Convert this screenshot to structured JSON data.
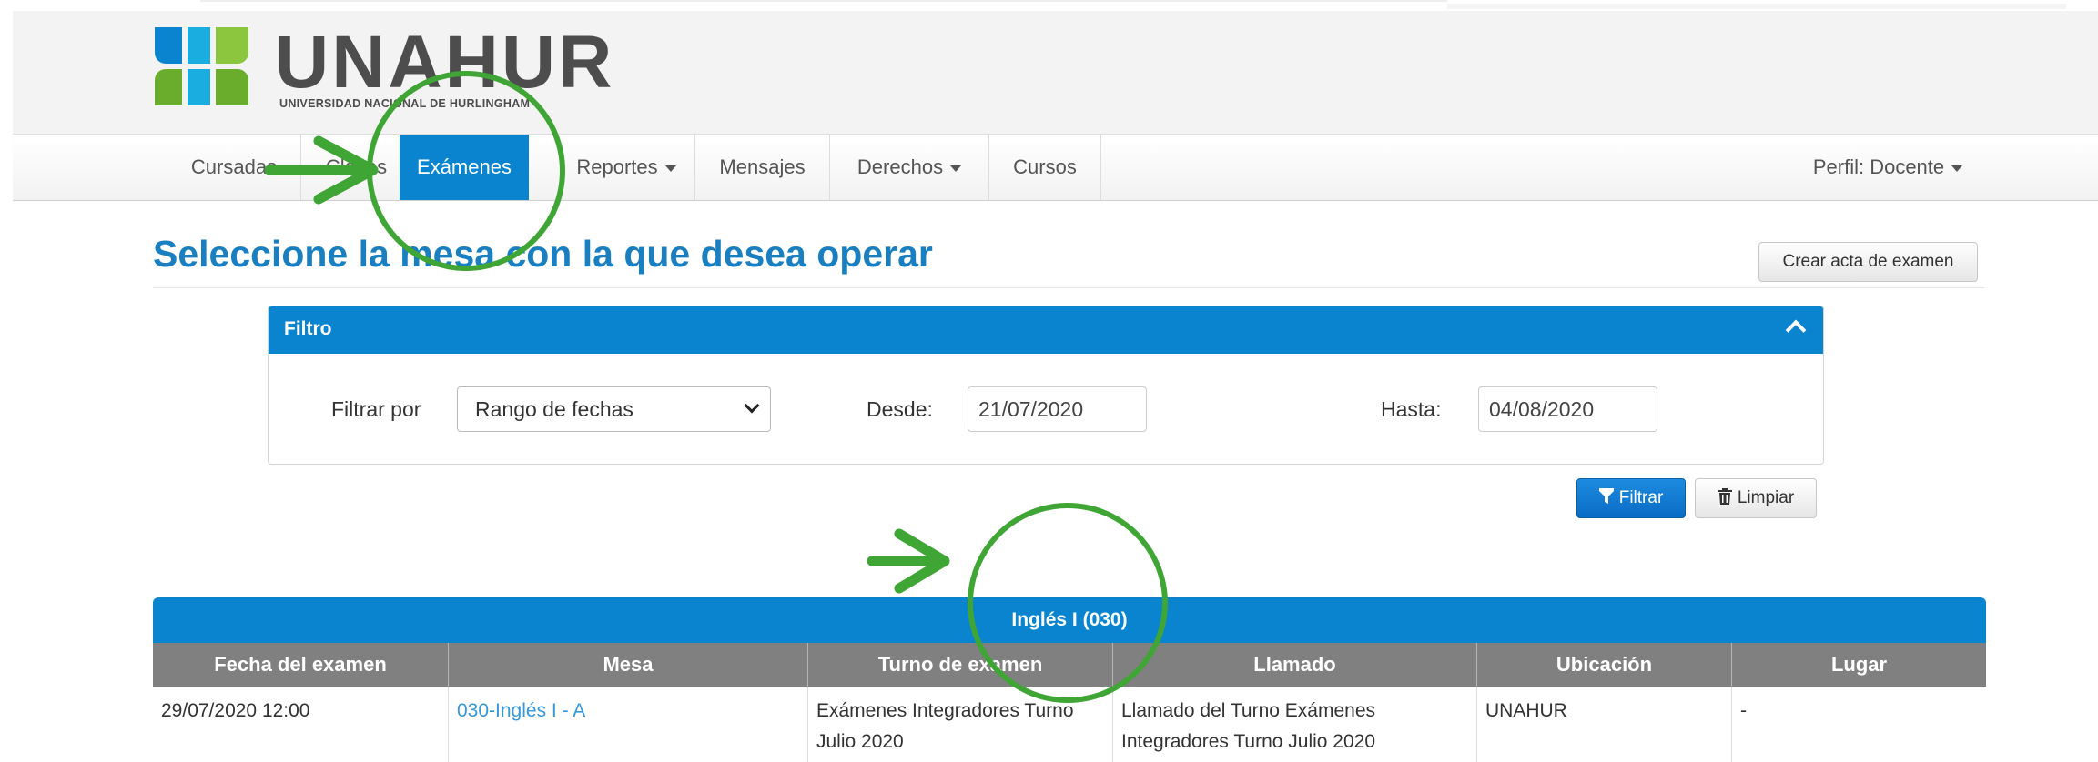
{
  "brand": {
    "name": "UNAHUR",
    "subtitle": "UNIVERSIDAD NACIONAL DE HURLINGHAM",
    "logo_colors": [
      "#0b84cf",
      "#6aad2c",
      "#1aaee0",
      "#8cc63f"
    ]
  },
  "nav": {
    "items": [
      {
        "label": "Cursadas"
      },
      {
        "label": "Clases"
      },
      {
        "label": "Exámenes"
      },
      {
        "label": "Reportes"
      },
      {
        "label": "Mensajes"
      },
      {
        "label": "Derechos"
      },
      {
        "label": "Cursos"
      }
    ],
    "active": "Exámenes",
    "profile": "Perfil: Docente"
  },
  "page": {
    "title": "Seleccione la mesa con la que desea operar",
    "create_button": "Crear acta de examen"
  },
  "filter": {
    "panel_title": "Filtro",
    "filter_by_label": "Filtrar por",
    "filter_by_value": "Rango de fechas",
    "from_label": "Desde:",
    "from_value": "21/07/2020",
    "to_label": "Hasta:",
    "to_value": "04/08/2020",
    "apply_button": "Filtrar",
    "clear_button": "Limpiar"
  },
  "table": {
    "title": "Inglés I (030)",
    "columns": [
      "Fecha del examen",
      "Mesa",
      "Turno de examen",
      "Llamado",
      "Ubicación",
      "Lugar"
    ],
    "rows": [
      {
        "fecha": "29/07/2020 12:00",
        "mesa": "030-Inglés I - A",
        "turno": "Exámenes Integradores Turno Julio 2020",
        "llamado": "Llamado del Turno Exámenes Integradores Turno Julio 2020",
        "ubicacion": "UNAHUR",
        "lugar": "-"
      }
    ]
  },
  "colors": {
    "primary": "#0b84cf",
    "title": "#1a7fc1",
    "annotation": "#3fa535",
    "table_header": "#808080",
    "link": "#3498db"
  }
}
